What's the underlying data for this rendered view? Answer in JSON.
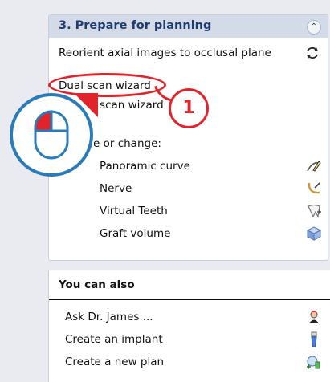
{
  "task": {
    "title": "3. Prepare for planning",
    "collapse_icon": "double-chevron-up-icon",
    "reorient": "Reorient axial images to occlusal plane",
    "dual_scan": "Dual scan wizard",
    "second_scan": "l scan wizard",
    "create_change": "e or change:",
    "items": [
      {
        "label": "Panoramic curve",
        "icon": "pen-curve-icon"
      },
      {
        "label": "Nerve",
        "icon": "nerve-icon"
      },
      {
        "label": "Virtual Teeth",
        "icon": "tooth-add-icon"
      },
      {
        "label": "Graft volume",
        "icon": "cube-icon"
      }
    ]
  },
  "also": {
    "title": "You can also",
    "items": [
      {
        "label": "Ask Dr. James ...",
        "icon": "doctor-icon"
      },
      {
        "label": "Create an implant",
        "icon": "implant-icon"
      },
      {
        "label": "Create a new plan",
        "icon": "new-plan-icon"
      }
    ]
  },
  "callout": {
    "number": "1",
    "accent": "#e1242c",
    "mouse_color": "#2a7bb8"
  }
}
